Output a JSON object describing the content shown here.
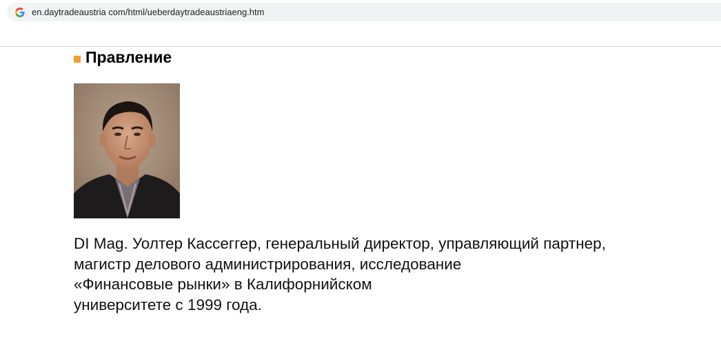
{
  "browser": {
    "url": "en.daytradeaustria com/html/ueberdaytradeaustriaeng.htm",
    "site_icon": "google-g-icon"
  },
  "section": {
    "title": "Правление",
    "bullet_color": "#f39c32"
  },
  "profile": {
    "photo_icon": "portrait-photo",
    "bio_lines": [
      "DI Mag. Уолтер Кассеггер, генеральный директор, управляющий партнер,",
      "магистр делового администрирования, исследование",
      "«Финансовые рынки» в Калифорнийском",
      "университете с 1999 года."
    ]
  }
}
